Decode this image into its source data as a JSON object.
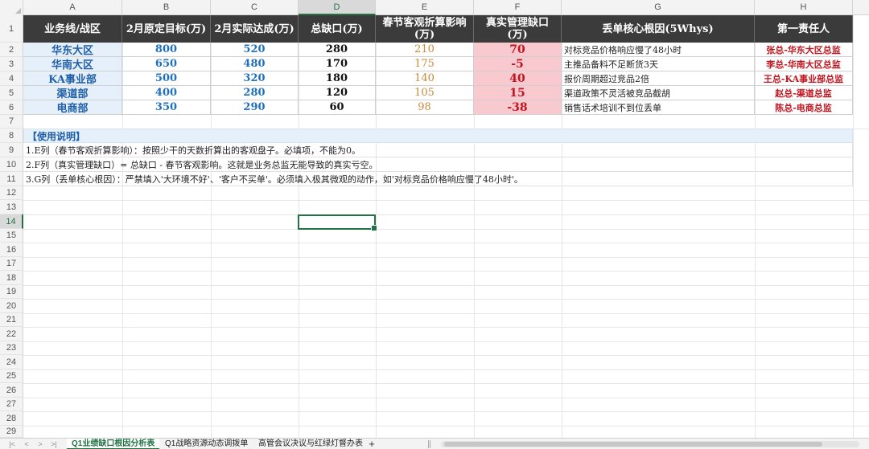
{
  "columns": [
    "A",
    "B",
    "C",
    "D",
    "E",
    "F",
    "G",
    "H"
  ],
  "active_column": "D",
  "rows": [
    "1",
    "2",
    "3",
    "4",
    "5",
    "6",
    "7",
    "8",
    "9",
    "10",
    "11",
    "12",
    "13",
    "14",
    "15",
    "16",
    "17",
    "18",
    "19",
    "20",
    "21",
    "22",
    "23",
    "24",
    "25",
    "26",
    "27",
    "28",
    "29"
  ],
  "active_row": "14",
  "headers": {
    "a": "业务线/战区",
    "b": "2月原定目标(万)",
    "c": "2月实际达成(万)",
    "d": "总缺口(万)",
    "e": "春节客观折算影响(万)",
    "f": "真实管理缺口(万)",
    "g": "丢单核心根因(5Whys)",
    "h": "第一责任人"
  },
  "data_rows": [
    {
      "a": "华东大区",
      "b": "800",
      "c": "520",
      "d": "280",
      "e": "210",
      "f": "70",
      "g": "对标竞品价格响应慢了48小时",
      "h": "张总-华东大区总监"
    },
    {
      "a": "华南大区",
      "b": "650",
      "c": "480",
      "d": "170",
      "e": "175",
      "f": "-5",
      "g": "主推品备料不足断货3天",
      "h": "李总-华南大区总监"
    },
    {
      "a": "KA事业部",
      "b": "500",
      "c": "320",
      "d": "180",
      "e": "140",
      "f": "40",
      "g": "报价周期超过竞品2倍",
      "h": "王总-KA事业部总监"
    },
    {
      "a": "渠道部",
      "b": "400",
      "c": "280",
      "d": "120",
      "e": "105",
      "f": "15",
      "g": "渠道政策不灵活被竞品截胡",
      "h": "赵总-渠道总监"
    },
    {
      "a": "电商部",
      "b": "350",
      "c": "290",
      "d": "60",
      "e": "98",
      "f": "-38",
      "g": "销售话术培训不到位丢单",
      "h": "陈总-电商总监"
    }
  ],
  "notes": {
    "title": "【使用说明】",
    "line1": "1.E列（春节客观折算影响）：按照少干的天数折算出的客观盘子。必填项，不能为0。",
    "line2": "2.F列（真实管理缺口）= 总缺口 - 春节客观影响。这就是业务总监无能导致的真实亏空。",
    "line3": "3.G列（丢单核心根因）：严禁填入'大环境不好'、'客户不买单'。必须填入极其微观的动作，如'对标竞品价格响应慢了48小时'。"
  },
  "tabs": {
    "nav": [
      "|<",
      "<",
      ">",
      ">|"
    ],
    "sheet1": "Q1业绩缺口根因分析表",
    "sheet2": "Q1战略资源动态调拨单",
    "sheet3": "高管会议决议与红绿灯督办表",
    "add": "+"
  },
  "colors": {
    "header_bg": "#3b3b3b",
    "accent_green": "#217346",
    "gap_red": "#c0141e",
    "gap_bg": "#f8c9cf",
    "target_blue": "#1f6fbf"
  }
}
